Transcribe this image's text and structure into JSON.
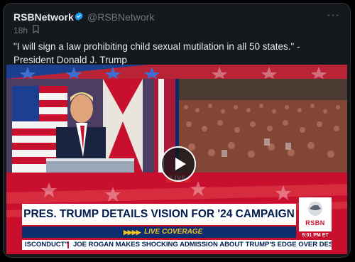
{
  "tweet": {
    "author_name": "RSBNetwork",
    "handle": "@RSBNetwork",
    "timestamp": "18h",
    "text": "\"I will sign a law prohibiting child sexual mutilation in all 50 states.\" - President Donald J. Trump",
    "more_label": "···"
  },
  "video": {
    "live_tag": "LIVE",
    "headline": "PRES. TRUMP DETAILS VISION FOR '24 CAMPAIGN",
    "live_coverage_arrows": "▶▶▶▶",
    "live_coverage": "LIVE COVERAGE",
    "logo_text": "RSBN",
    "time": "9:01 PM ET",
    "ticker_left": "ISCONDUCT\"",
    "ticker_right": "JOE ROGAN MAKES SHOCKING ADMISSION ABOUT TRUMP'S EDGE OVER DESANTIS"
  },
  "colors": {
    "background": "#000000",
    "card": "#15181c",
    "verified": "#1d9bf0",
    "muted_text": "#71767b",
    "rsbn_red": "#c8102e",
    "rsbn_navy": "#001b4e",
    "live_gold": "#f2c320"
  },
  "icons": {
    "verified": "verified-badge-icon",
    "save": "save-icon",
    "more": "more-icon",
    "play": "play-icon"
  }
}
